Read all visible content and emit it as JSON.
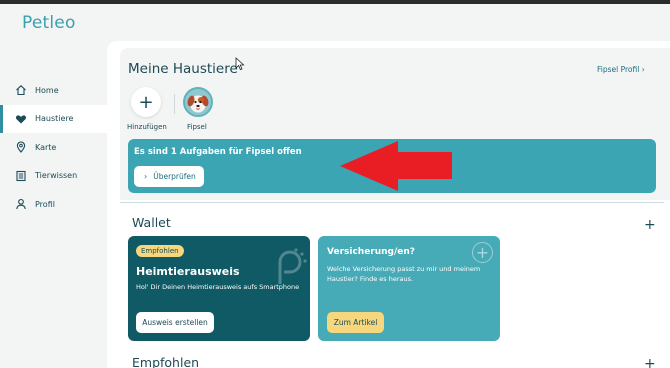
{
  "app": {
    "logo_text": "Petleo",
    "accent": "#3ba5b3",
    "dark_teal": "#0f5a64"
  },
  "sidebar": {
    "items": [
      {
        "label": "Home",
        "icon": "home-icon",
        "active": false
      },
      {
        "label": "Haustiere",
        "icon": "heart-icon",
        "active": true
      },
      {
        "label": "Karte",
        "icon": "map-pin-icon",
        "active": false
      },
      {
        "label": "Tierwissen",
        "icon": "book-icon",
        "active": false
      },
      {
        "label": "Profil",
        "icon": "user-icon",
        "active": false
      }
    ]
  },
  "pets": {
    "title": "Meine Haustiere",
    "profile_link": "Fipsel Profil",
    "add_label": "Hinzufügen",
    "pet_name": "Fipsel",
    "task_text": "Es sind 1 Aufgaben für Fipsel offen",
    "review_button": "Überprüfen"
  },
  "wallet": {
    "title": "Wallet",
    "id_card": {
      "badge": "Empfohlen",
      "title": "Heimtierausweis",
      "subtitle": "Hol' Dir Deinen Heimtierausweis aufs Smartphone",
      "button": "Ausweis erstellen"
    },
    "insurance_card": {
      "title": "Versicherung/en?",
      "subtitle": "Welche Versicherung passt zu mir und meinem Haustier? Finde es heraus.",
      "button": "Zum Artikel"
    }
  },
  "recommended": {
    "title": "Empfohlen"
  }
}
